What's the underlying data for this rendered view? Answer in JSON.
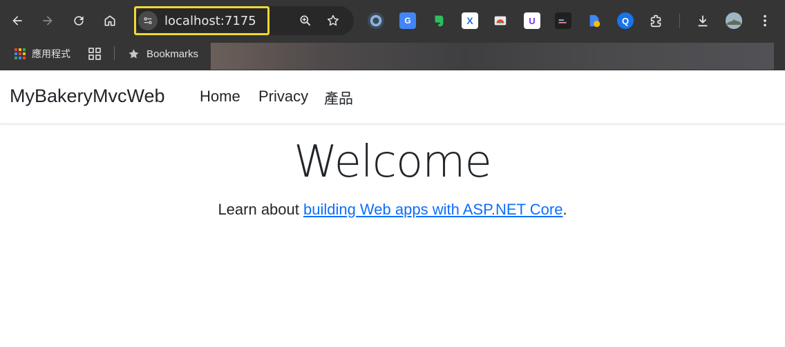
{
  "browser": {
    "url": "localhost:7175",
    "bookmarks_bar": {
      "apps_label": "應用程式",
      "bookmarks_label": "Bookmarks"
    }
  },
  "navbar": {
    "brand": "MyBakeryMvcWeb",
    "links": [
      "Home",
      "Privacy",
      "產品"
    ]
  },
  "main": {
    "heading": "Welcome",
    "lead_prefix": "Learn about ",
    "lead_link": "building Web apps with ASP.NET Core",
    "lead_suffix": "."
  },
  "colors": {
    "chrome_bg": "#353535",
    "highlight": "#f1d833",
    "link": "#0d6efd",
    "text": "#212529"
  }
}
